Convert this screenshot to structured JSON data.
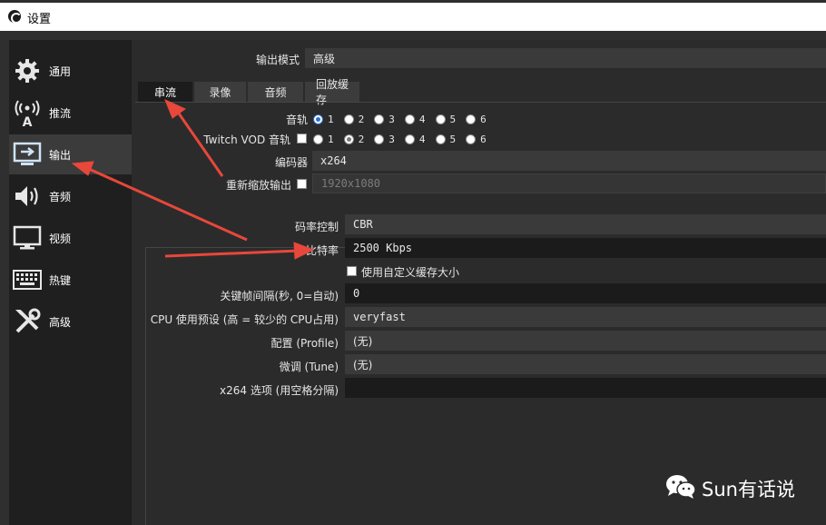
{
  "window": {
    "title": "设置"
  },
  "sidebar": {
    "items": [
      {
        "label": "通用",
        "icon": "gear-icon"
      },
      {
        "label": "推流",
        "icon": "broadcast-icon"
      },
      {
        "label": "输出",
        "icon": "output-monitor-icon",
        "active": true
      },
      {
        "label": "音频",
        "icon": "speaker-icon"
      },
      {
        "label": "视频",
        "icon": "monitor-icon"
      },
      {
        "label": "热键",
        "icon": "keyboard-icon"
      },
      {
        "label": "高级",
        "icon": "tools-icon"
      }
    ]
  },
  "output": {
    "mode_label": "输出模式",
    "mode_value": "高级",
    "tabs": [
      "串流",
      "录像",
      "音频",
      "回放缓存"
    ],
    "active_tab": "串流",
    "audio_track_label": "音轨",
    "twitch_vod_label": "Twitch VOD 音轨",
    "track_numbers": [
      "1",
      "2",
      "3",
      "4",
      "5",
      "6"
    ],
    "audio_track_selected": "1",
    "twitch_vod_selected": "2",
    "encoder_label": "编码器",
    "encoder_value": "x264",
    "rescale_label": "重新缩放输出",
    "rescale_value": "1920x1080",
    "rate_control_label": "码率控制",
    "rate_control_value": "CBR",
    "bitrate_label": "比特率",
    "bitrate_value": "2500 Kbps",
    "custom_buffer_label": "使用自定义缓存大小",
    "keyframe_label": "关键帧间隔(秒, 0=自动)",
    "keyframe_value": "0",
    "cpu_preset_label": "CPU 使用预设 (高 = 较少的 CPU占用)",
    "cpu_preset_value": "veryfast",
    "profile_label": "配置 (Profile)",
    "profile_value": "(无)",
    "tune_label": "微调 (Tune)",
    "tune_value": "(无)",
    "x264_options_label": "x264 选项 (用空格分隔)",
    "x264_options_value": ""
  },
  "watermark": {
    "text": "Sun有话说",
    "icon": "wechat-icon"
  },
  "colors": {
    "annotation_arrow": "#e8473b",
    "radio_selected": "#2f6fd0"
  }
}
